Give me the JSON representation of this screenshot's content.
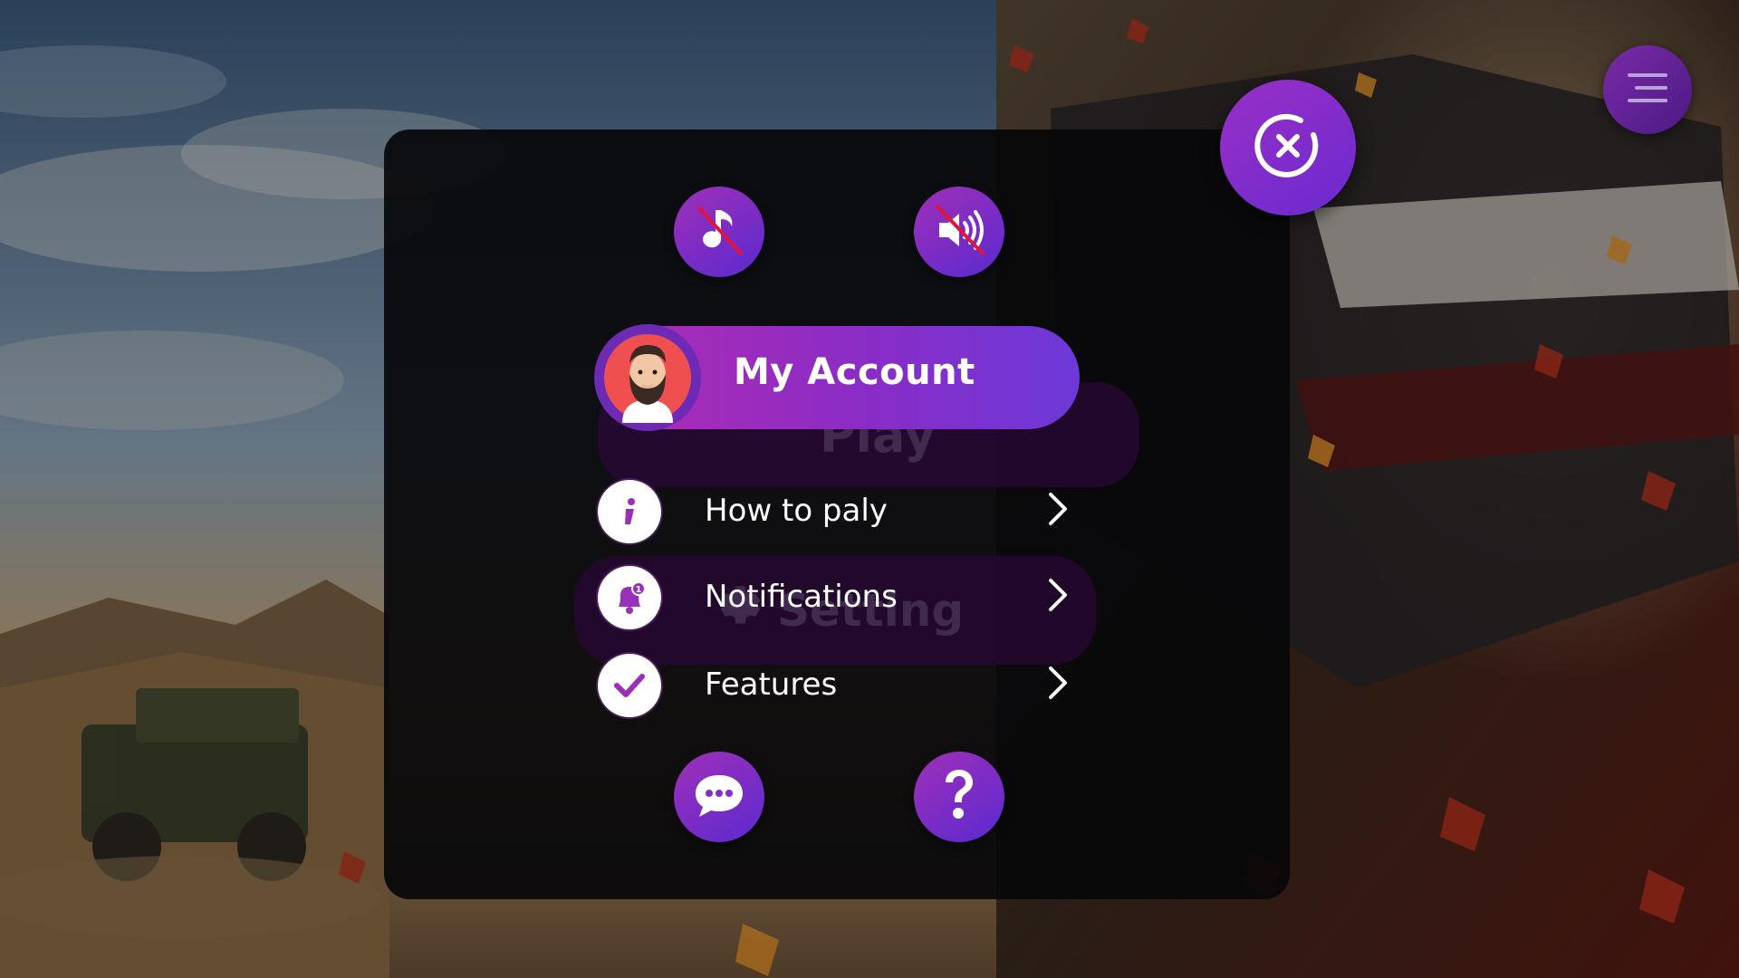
{
  "background": {
    "ghost_play_label": "Play",
    "ghost_setting_label": "Setting"
  },
  "panel": {
    "top_buttons": [
      {
        "icon": "music-muted-icon"
      },
      {
        "icon": "sound-muted-icon"
      }
    ],
    "account_label": "My Account",
    "menu_items": [
      {
        "label": "How to paly",
        "icon": "info-icon"
      },
      {
        "label": "Notifications",
        "icon": "bell-icon"
      },
      {
        "label": "Features",
        "icon": "check-icon"
      }
    ],
    "bottom_buttons": [
      {
        "icon": "chat-icon"
      },
      {
        "icon": "help-icon"
      }
    ]
  },
  "colors": {
    "accent_purple": "#8a2cc6",
    "accent_magenta": "#b02db2",
    "mute_slash": "#e0143c"
  }
}
